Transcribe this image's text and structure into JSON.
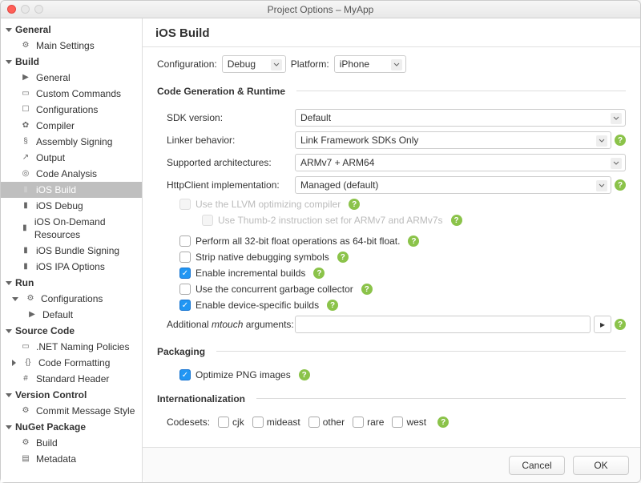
{
  "window": {
    "title": "Project Options – MyApp"
  },
  "sidebar": {
    "groups": [
      {
        "label": "General",
        "items": [
          {
            "label": "Main Settings",
            "icon": "gear-icon"
          }
        ]
      },
      {
        "label": "Build",
        "items": [
          {
            "label": "General",
            "icon": "play-icon"
          },
          {
            "label": "Custom Commands",
            "icon": "terminal-icon"
          },
          {
            "label": "Configurations",
            "icon": "stack-icon"
          },
          {
            "label": "Compiler",
            "icon": "cog-icon"
          },
          {
            "label": "Assembly Signing",
            "icon": "key-icon"
          },
          {
            "label": "Output",
            "icon": "arrow-icon"
          },
          {
            "label": "Code Analysis",
            "icon": "search-icon"
          },
          {
            "label": "iOS Build",
            "icon": "device-icon",
            "selected": true
          },
          {
            "label": "iOS Debug",
            "icon": "device-icon"
          },
          {
            "label": "iOS On-Demand Resources",
            "icon": "device-icon"
          },
          {
            "label": "iOS Bundle Signing",
            "icon": "device-icon"
          },
          {
            "label": "iOS IPA Options",
            "icon": "device-icon"
          }
        ]
      },
      {
        "label": "Run",
        "items": [
          {
            "label": "Configurations",
            "icon": "tree-icon",
            "expanded": true,
            "children": [
              {
                "label": "Default",
                "icon": "play-icon"
              }
            ]
          }
        ]
      },
      {
        "label": "Source Code",
        "items": [
          {
            "label": ".NET Naming Policies",
            "icon": "badge-icon"
          },
          {
            "label": "Code Formatting",
            "icon": "bracket-icon",
            "collapsed": true
          },
          {
            "label": "Standard Header",
            "icon": "hash-icon"
          }
        ]
      },
      {
        "label": "Version Control",
        "items": [
          {
            "label": "Commit Message Style",
            "icon": "gear-icon"
          }
        ]
      },
      {
        "label": "NuGet Package",
        "items": [
          {
            "label": "Build",
            "icon": "gear-icon"
          },
          {
            "label": "Metadata",
            "icon": "doc-icon"
          }
        ]
      }
    ]
  },
  "page": {
    "title": "iOS Build",
    "config_label": "Configuration:",
    "config_value": "Debug",
    "platform_label": "Platform:",
    "platform_value": "iPhone",
    "sections": {
      "codegen": {
        "title": "Code Generation & Runtime",
        "sdk_label": "SDK version:",
        "sdk_value": "Default",
        "linker_label": "Linker behavior:",
        "linker_value": "Link Framework SDKs Only",
        "arch_label": "Supported architectures:",
        "arch_value": "ARMv7 + ARM64",
        "http_label": "HttpClient implementation:",
        "http_value": "Managed (default)",
        "llvm_label": "Use the LLVM optimizing compiler",
        "thumb_label": "Use Thumb-2 instruction set for ARMv7 and ARMv7s",
        "float_label": "Perform all 32-bit float operations as 64-bit float.",
        "strip_label": "Strip native debugging symbols",
        "incremental_label": "Enable incremental builds",
        "gc_label": "Use the concurrent garbage collector",
        "device_label": "Enable device-specific builds",
        "mtouch_label_pre": "Additional ",
        "mtouch_label_em": "mtouch",
        "mtouch_label_post": " arguments:",
        "mtouch_value": ""
      },
      "packaging": {
        "title": "Packaging",
        "optimize_png_label": "Optimize PNG images"
      },
      "i18n": {
        "title": "Internationalization",
        "codesets_label": "Codesets:",
        "codesets": [
          "cjk",
          "mideast",
          "other",
          "rare",
          "west"
        ]
      }
    }
  },
  "footer": {
    "cancel": "Cancel",
    "ok": "OK"
  }
}
